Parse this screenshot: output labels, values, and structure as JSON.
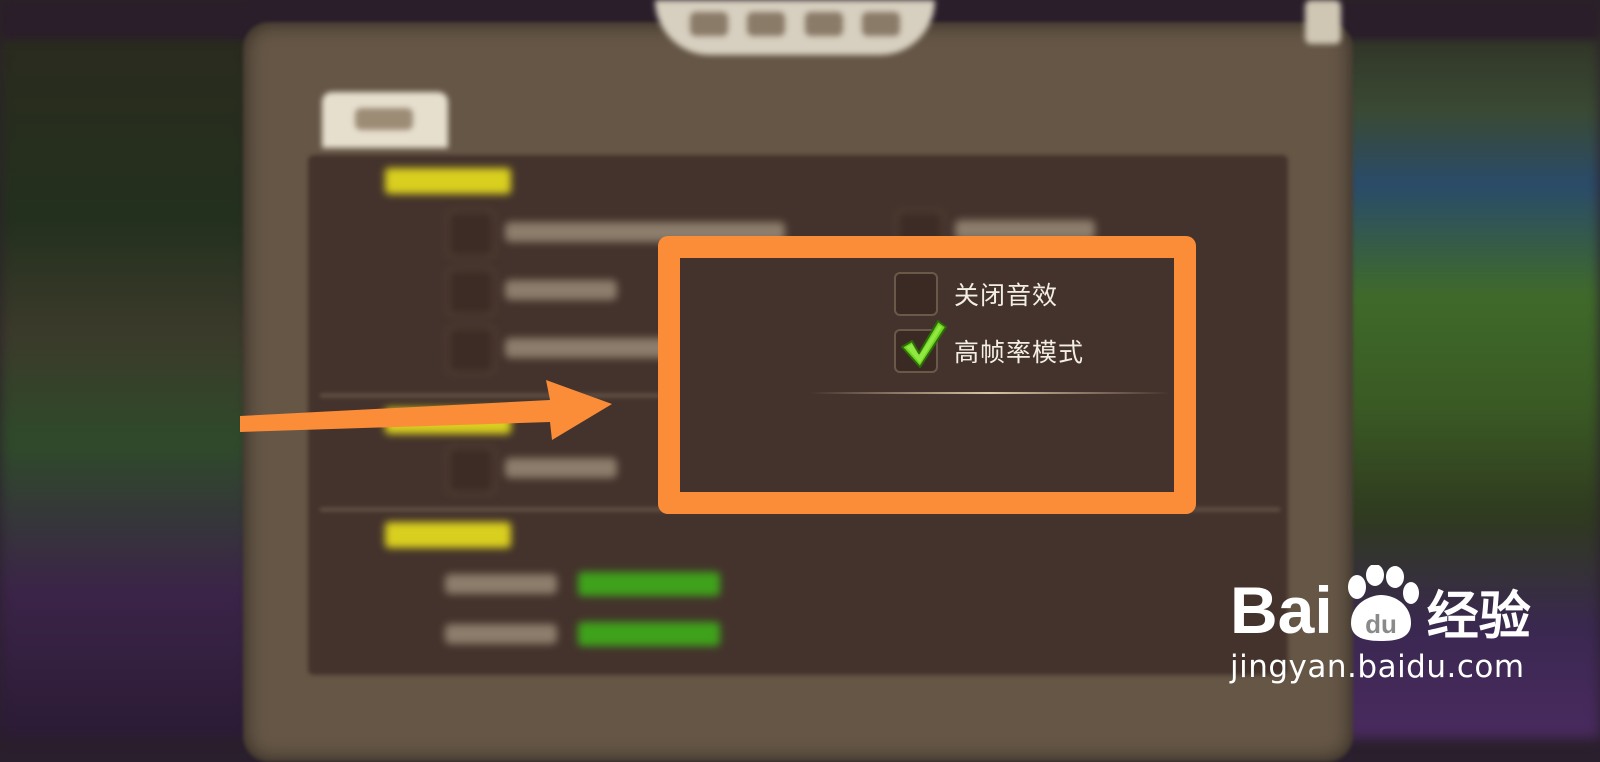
{
  "settings": {
    "options": [
      {
        "label": "关闭音效",
        "checked": false
      },
      {
        "label": "高帧率模式",
        "checked": true
      }
    ]
  },
  "highlight_color": "#fb8d39",
  "watermark": {
    "brand_left": "Bai",
    "brand_right": "经验",
    "url": "jingyan.baidu.com"
  }
}
